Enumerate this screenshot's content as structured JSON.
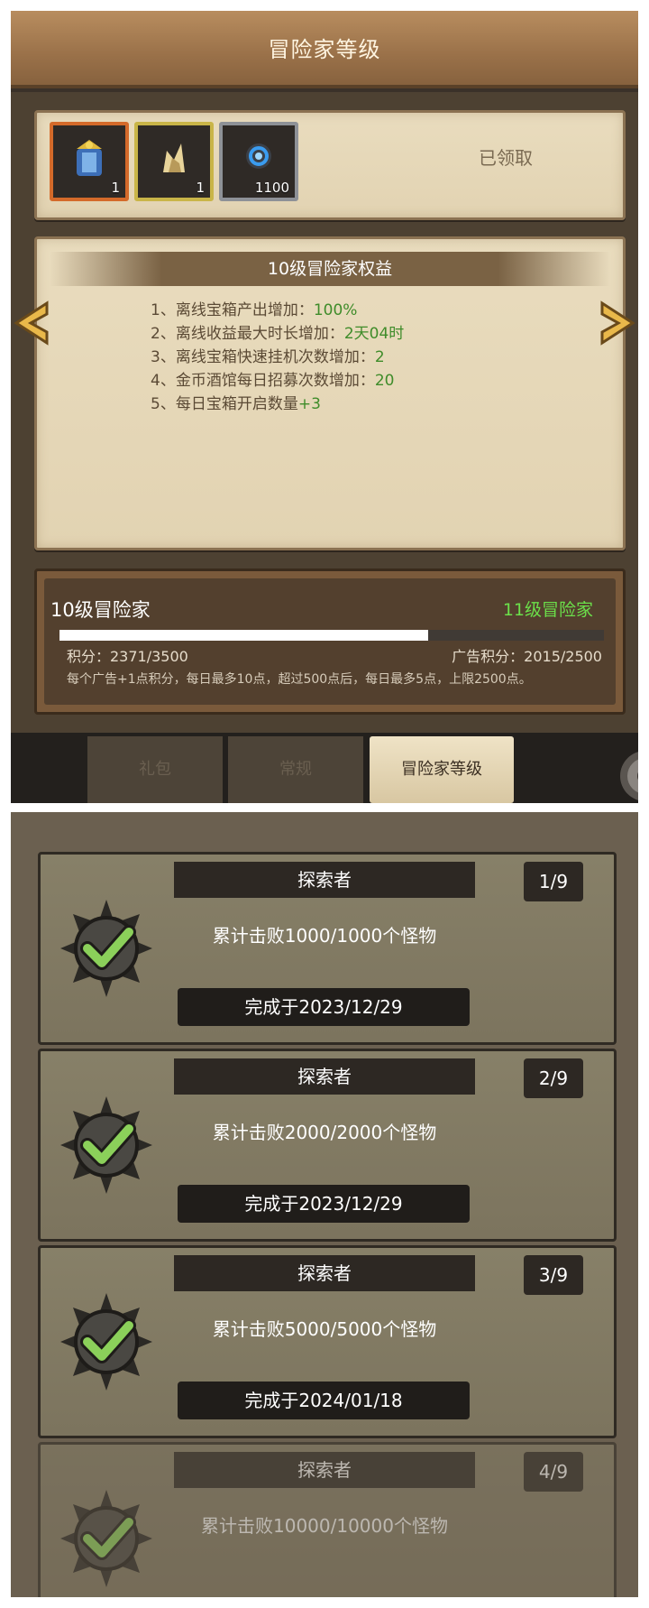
{
  "screen_top": {
    "title": "冒险家等级",
    "rewards": [
      {
        "icon": "armor-icon",
        "count": "1",
        "frame_color": "#d46a2a"
      },
      {
        "icon": "helmet-horn-icon",
        "count": "1",
        "frame_color": "#c9b548"
      },
      {
        "icon": "gem-ring-icon",
        "count": "1100",
        "frame_color": "#8e9197"
      }
    ],
    "claimed_label": "已领取",
    "benefits_title": "10级冒险家权益",
    "benefits": [
      {
        "text": "1、离线宝箱产出增加：",
        "value": "100%"
      },
      {
        "text": "2、离线收益最大时长增加：",
        "value": "2天04时"
      },
      {
        "text": "3、离线宝箱快速挂机次数增加：",
        "value": "2"
      },
      {
        "text": "4、金币酒馆每日招募次数增加：",
        "value": "20"
      },
      {
        "text": "5、每日宝箱开启数量",
        "value": "+3"
      }
    ],
    "current_level": "10级冒险家",
    "next_level": "11级冒险家",
    "progress_fraction": 0.677,
    "points": "积分：2371/3500",
    "ad_points": "广告积分：2015/2500",
    "rule": "每个广告+1点积分，每日最多10点，超过500点后，每日最多5点，上限2500点。",
    "tabs": [
      {
        "label": "礼包",
        "active": false
      },
      {
        "label": "常规",
        "active": false
      },
      {
        "label": "冒险家等级",
        "active": true
      }
    ]
  },
  "screen_bottom": {
    "achievements": [
      {
        "title": "探索者",
        "count": "1/9",
        "desc": "累计击败1000/1000个怪物",
        "date": "完成于2023/12/29"
      },
      {
        "title": "探索者",
        "count": "2/9",
        "desc": "累计击败2000/2000个怪物",
        "date": "完成于2023/12/29"
      },
      {
        "title": "探索者",
        "count": "3/9",
        "desc": "累计击败5000/5000个怪物",
        "date": "完成于2024/01/18"
      },
      {
        "title": "探索者",
        "count": "4/9",
        "desc": "累计击败10000/10000个怪物",
        "date": ""
      }
    ]
  },
  "colors": {
    "green_value": "#3f8c2a",
    "next_level_green": "#6be04a"
  }
}
